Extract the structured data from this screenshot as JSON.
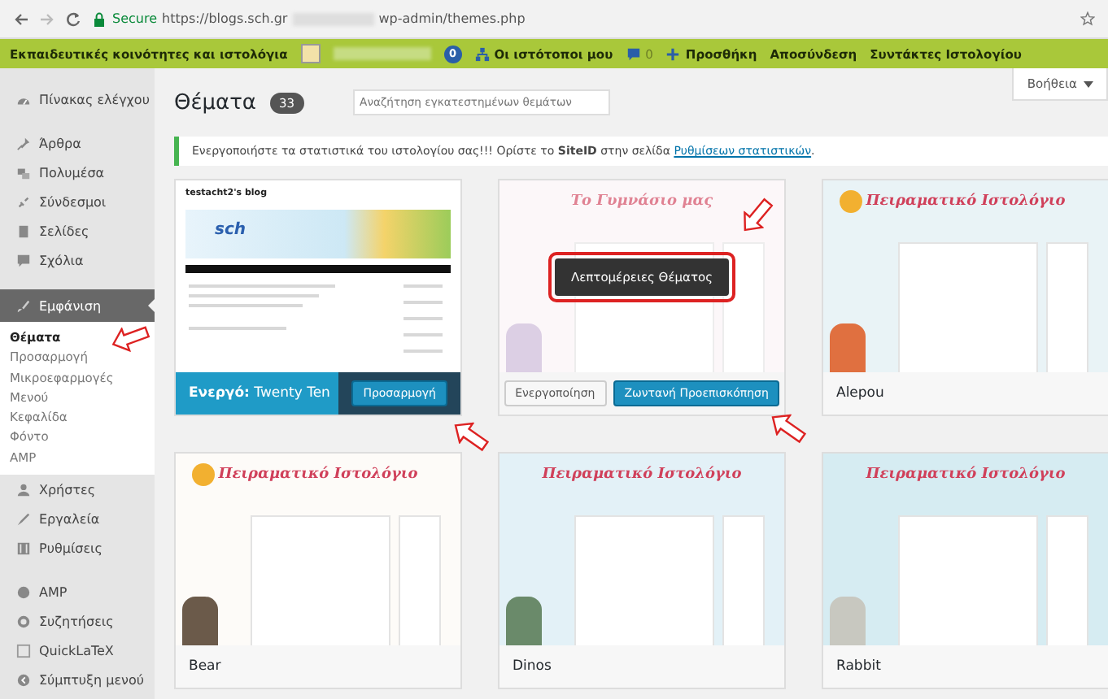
{
  "browser": {
    "secure_label": "Secure",
    "url_host": "https://blogs.sch.gr",
    "url_path": "wp-admin/themes.php"
  },
  "admin_bar": {
    "site_label": "Εκπαιδευτικές κοινότητες και ιστολόγια",
    "badge": "0",
    "my_sites": "Οι ιστότοποι μου",
    "comments": "0",
    "add_new": "Προσθήκη",
    "logout": "Αποσύνδεση",
    "authors": "Συντάκτες Ιστολογίου"
  },
  "sidebar": {
    "groups": [
      [
        {
          "label": "Πίνακας ελέγχου",
          "selected": false
        }
      ],
      [
        {
          "label": "Άρθρα",
          "selected": false
        },
        {
          "label": "Πολυμέσα",
          "selected": false
        },
        {
          "label": "Σύνδεσμοι",
          "selected": false
        },
        {
          "label": "Σελίδες",
          "selected": false
        },
        {
          "label": "Σχόλια",
          "selected": false
        }
      ],
      [
        {
          "label": "Εμφάνιση",
          "selected": true,
          "children": [
            {
              "label": "Θέματα",
              "selected": true
            },
            {
              "label": "Προσαρμογή",
              "selected": false
            },
            {
              "label": "Μικροεφαρμογές",
              "selected": false
            },
            {
              "label": "Μενού",
              "selected": false
            },
            {
              "label": "Κεφαλίδα",
              "selected": false
            },
            {
              "label": "Φόντο",
              "selected": false
            },
            {
              "label": "AMP",
              "selected": false
            }
          ]
        },
        {
          "label": "Χρήστες",
          "selected": false
        },
        {
          "label": "Εργαλεία",
          "selected": false
        },
        {
          "label": "Ρυθμίσεις",
          "selected": false
        }
      ],
      [
        {
          "label": "AMP",
          "selected": false
        },
        {
          "label": "Συζητήσεις",
          "selected": false
        },
        {
          "label": "QuickLaTeX",
          "selected": false
        },
        {
          "label": "Σύμπτυξη μενού",
          "selected": false
        }
      ]
    ]
  },
  "header": {
    "title": "Θέματα",
    "count": "33",
    "search": {
      "placeholder": "Αναζήτηση εγκατεστημένων θεμάτων"
    },
    "help": "Βοήθεια"
  },
  "notice": {
    "text": "Ενεργοποιήστε τα στατιστικά του ιστολογίου σας!!! Ορίστε το **SiteID** στην σελίδα ",
    "link": "Ρυθμίσεων στατιστικών",
    "after": "."
  },
  "themes": [
    {
      "kind": "active",
      "preview": {
        "title": "testacht2's blog",
        "logo": "sch"
      },
      "active_label": "Ενεργό:",
      "name": "Twenty Ten",
      "button": "Προσαρμογή"
    },
    {
      "kind": "hover",
      "preview": {
        "title": "Το Γυμνάσιο μας"
      },
      "details": "Λεπτομέρειες Θέματος",
      "buttons": [
        "Ενεργοποίηση",
        "Ζωντανή Προεπισκόπηση"
      ]
    },
    {
      "kind": "plain",
      "preview": {
        "title": "Πειραματικό Ιστολόγιο"
      },
      "name": "Alepou"
    },
    {
      "kind": "plain",
      "preview": {
        "title": "Πειραματικό Ιστολόγιο"
      },
      "name": "Bear"
    },
    {
      "kind": "plain",
      "preview": {
        "title": "Πειραματικό Ιστολόγιο"
      },
      "name": "Dinos"
    },
    {
      "kind": "plain",
      "preview": {
        "title": "Πειραματικό Ιστολόγιο"
      },
      "name": "Rabbit"
    }
  ]
}
